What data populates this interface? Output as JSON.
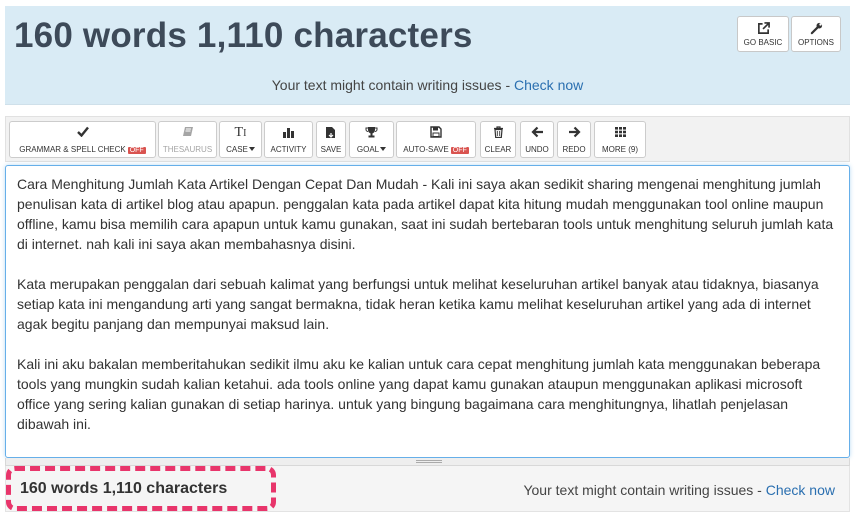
{
  "header": {
    "word_count_title": "160 words 1,110 characters",
    "issues_text": "Your text might contain writing issues - ",
    "check_now": "Check now",
    "go_basic_label": "GO BASIC",
    "options_label": "OPTIONS"
  },
  "toolbar": {
    "grammar_label": "GRAMMAR & SPELL CHECK",
    "grammar_badge": "OFF",
    "thesaurus_label": "THESAURUS",
    "case_label": "CASE",
    "activity_label": "ACTIVITY",
    "save_label": "SAVE",
    "goal_label": "GOAL",
    "autosave_label": "AUTO-SAVE",
    "autosave_badge": "OFF",
    "clear_label": "CLEAR",
    "undo_label": "UNDO",
    "redo_label": "REDO",
    "more_label": "MORE (9)"
  },
  "editor": {
    "paragraphs": [
      "Cara Menghitung Jumlah Kata Artikel Dengan Cepat Dan Mudah - Kali ini saya akan sedikit sharing mengenai menghitung jumlah penulisan kata di artikel blog atau apapun. penggalan kata pada artikel dapat kita hitung mudah menggunakan tool online maupun offline, kamu bisa memilih cara apapun untuk kamu gunakan, saat ini sudah bertebaran tools untuk menghitung seluruh jumlah kata di internet. nah kali ini saya akan membahasnya disini.",
      "Kata merupakan penggalan dari sebuah kalimat yang berfungsi untuk melihat keseluruhan artikel banyak atau tidaknya, biasanya setiap kata ini mengandung arti yang sangat bermakna, tidak heran ketika kamu melihat keseluruhan artikel yang ada di internet agak begitu panjang dan mempunyai maksud lain.",
      "Kali ini aku bakalan memberitahukan sedikit ilmu aku ke kalian untuk cara cepat menghitung jumlah kata menggunakan beberapa tools yang mungkin sudah kalian ketahui. ada tools online yang dapat kamu gunakan ataupun menggunakan aplikasi microsoft office yang sering kalian gunakan di setiap harinya. untuk yang bingung bagaimana cara menghitungnya, lihatlah penjelasan dibawah ini."
    ]
  },
  "footer": {
    "word_count": "160 words 1,110 characters",
    "issues_text": "Your text might contain writing issues - ",
    "check_now": "Check now"
  },
  "colors": {
    "header_bg": "#d9ebf5",
    "title_color": "#3d4a59",
    "link": "#2a6fb0",
    "off_badge": "#d9534f",
    "highlight": "#e8356b",
    "spell_underline": "#e0301e"
  }
}
